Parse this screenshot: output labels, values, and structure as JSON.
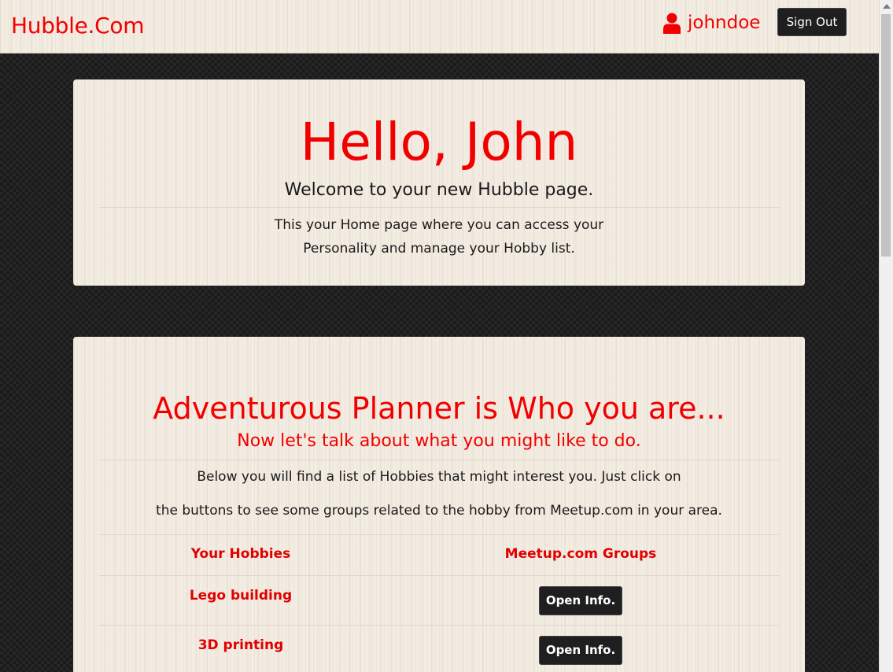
{
  "navbar": {
    "brand": "Hubble.Com",
    "username": "johndoe",
    "user_icon": "user-icon",
    "sign_out_label": "Sign Out"
  },
  "hello_card": {
    "title": "Hello, John",
    "welcome": "Welcome to your new Hubble page.",
    "intro_line1": "This your Home page where you can access your",
    "intro_line2": "Personality and manage your Hobby list."
  },
  "planner_card": {
    "title": "Adventurous Planner is Who you are...",
    "subtitle": "Now let's talk about what you might like to do.",
    "desc_line1": "Below you will find a list of Hobbies that might interest you. Just click on",
    "desc_line2": "the buttons to see some groups related to the hobby from Meetup.com in your area.",
    "table": {
      "headers": [
        "Your Hobbies",
        "Meetup.com Groups"
      ],
      "rows": [
        {
          "hobby": "Lego building",
          "button_label": "Open Info."
        },
        {
          "hobby": "3D printing",
          "button_label": "Open Info."
        }
      ]
    }
  },
  "colors": {
    "accent": "#f20000",
    "button_bg": "#1f1f1f",
    "card_bg": "#f3ece2"
  }
}
